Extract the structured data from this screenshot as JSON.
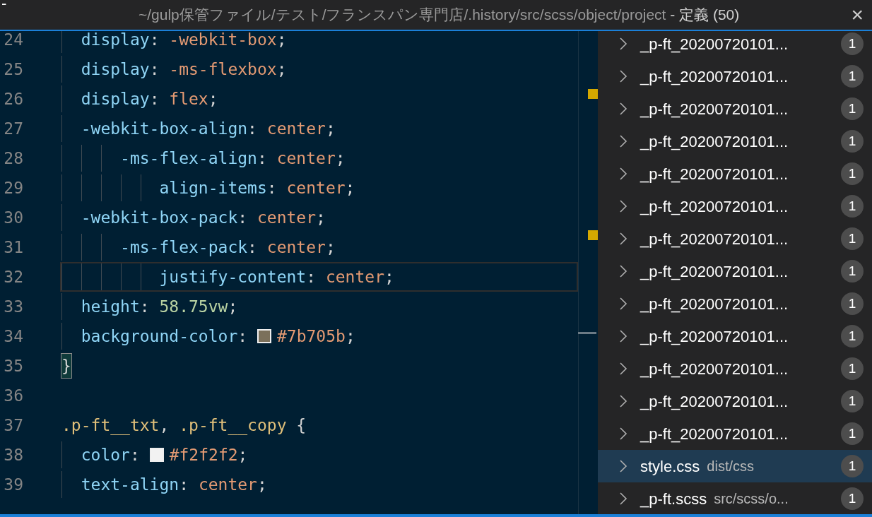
{
  "window": {
    "title_path": "~/gulp保管ファイル/テスト/フランスパン専門店/.history/src/scss/object/project",
    "title_suffix": " - 定義 (50)",
    "close": "×"
  },
  "tab_fragments": [
    "-"
  ],
  "editor": {
    "lines": [
      {
        "number": "24",
        "current": false,
        "tokens": [
          {
            "kind": "property",
            "text": "  display"
          },
          {
            "kind": "punct",
            "text": ": "
          },
          {
            "kind": "value",
            "text": "-webkit-box"
          },
          {
            "kind": "punct",
            "text": ";"
          }
        ]
      },
      {
        "number": "25",
        "current": false,
        "tokens": [
          {
            "kind": "property",
            "text": "  display"
          },
          {
            "kind": "punct",
            "text": ": "
          },
          {
            "kind": "value",
            "text": "-ms-flexbox"
          },
          {
            "kind": "punct",
            "text": ";"
          }
        ]
      },
      {
        "number": "26",
        "current": false,
        "tokens": [
          {
            "kind": "property",
            "text": "  display"
          },
          {
            "kind": "punct",
            "text": ": "
          },
          {
            "kind": "value",
            "text": "flex"
          },
          {
            "kind": "punct",
            "text": ";"
          }
        ]
      },
      {
        "number": "27",
        "current": false,
        "tokens": [
          {
            "kind": "property",
            "text": "  -webkit-box-align"
          },
          {
            "kind": "punct",
            "text": ": "
          },
          {
            "kind": "value",
            "text": "center"
          },
          {
            "kind": "punct",
            "text": ";"
          }
        ]
      },
      {
        "number": "28",
        "current": false,
        "tokens": [
          {
            "kind": "property",
            "text": "      -ms-flex-align"
          },
          {
            "kind": "punct",
            "text": ": "
          },
          {
            "kind": "value",
            "text": "center"
          },
          {
            "kind": "punct",
            "text": ";"
          }
        ]
      },
      {
        "number": "29",
        "current": false,
        "tokens": [
          {
            "kind": "property",
            "text": "          align-items"
          },
          {
            "kind": "punct",
            "text": ": "
          },
          {
            "kind": "value",
            "text": "center"
          },
          {
            "kind": "punct",
            "text": ";"
          }
        ]
      },
      {
        "number": "30",
        "current": false,
        "tokens": [
          {
            "kind": "property",
            "text": "  -webkit-box-pack"
          },
          {
            "kind": "punct",
            "text": ": "
          },
          {
            "kind": "value",
            "text": "center"
          },
          {
            "kind": "punct",
            "text": ";"
          }
        ]
      },
      {
        "number": "31",
        "current": false,
        "tokens": [
          {
            "kind": "property",
            "text": "      -ms-flex-pack"
          },
          {
            "kind": "punct",
            "text": ": "
          },
          {
            "kind": "value",
            "text": "center"
          },
          {
            "kind": "punct",
            "text": ";"
          }
        ]
      },
      {
        "number": "32",
        "current": true,
        "tokens": [
          {
            "kind": "property",
            "text": "          justify-content"
          },
          {
            "kind": "punct",
            "text": ": "
          },
          {
            "kind": "value",
            "text": "center"
          },
          {
            "kind": "punct",
            "text": ";"
          }
        ]
      },
      {
        "number": "33",
        "current": false,
        "tokens": [
          {
            "kind": "property",
            "text": "  height"
          },
          {
            "kind": "punct",
            "text": ": "
          },
          {
            "kind": "number",
            "text": "58.75vw"
          },
          {
            "kind": "punct",
            "text": ";"
          }
        ]
      },
      {
        "number": "34",
        "current": false,
        "tokens": [
          {
            "kind": "property",
            "text": "  background-color"
          },
          {
            "kind": "punct",
            "text": ": "
          },
          {
            "kind": "color",
            "text": "#7b705b",
            "color": "#7b705b"
          },
          {
            "kind": "punct",
            "text": ";"
          }
        ]
      },
      {
        "number": "35",
        "current": false,
        "tokens": [
          {
            "kind": "bracket",
            "text": "}"
          }
        ]
      },
      {
        "number": "36",
        "current": false
      },
      {
        "number": "37",
        "current": false,
        "tokens": [
          {
            "kind": "selector",
            "text": ".p-ft__txt"
          },
          {
            "kind": "punct",
            "text": ", "
          },
          {
            "kind": "selector",
            "text": ".p-ft__copy"
          },
          {
            "kind": "punct",
            "text": " {"
          }
        ]
      },
      {
        "number": "38",
        "current": false,
        "tokens": [
          {
            "kind": "property",
            "text": "  color"
          },
          {
            "kind": "punct",
            "text": ": "
          },
          {
            "kind": "color",
            "text": "#f2f2f2",
            "color": "#f2f2f2"
          },
          {
            "kind": "punct",
            "text": ";"
          }
        ]
      },
      {
        "number": "39",
        "current": false,
        "tokens": [
          {
            "kind": "property",
            "text": "  text-align"
          },
          {
            "kind": "punct",
            "text": ": "
          },
          {
            "kind": "value",
            "text": "center"
          },
          {
            "kind": "punct",
            "text": ";"
          }
        ]
      }
    ]
  },
  "references": [
    {
      "name": "_p-ft_20200720101...",
      "count": "1",
      "selected": false
    },
    {
      "name": "_p-ft_20200720101...",
      "count": "1",
      "selected": false
    },
    {
      "name": "_p-ft_20200720101...",
      "count": "1",
      "selected": false
    },
    {
      "name": "_p-ft_20200720101...",
      "count": "1",
      "selected": false
    },
    {
      "name": "_p-ft_20200720101...",
      "count": "1",
      "selected": false
    },
    {
      "name": "_p-ft_20200720101...",
      "count": "1",
      "selected": false
    },
    {
      "name": "_p-ft_20200720101...",
      "count": "1",
      "selected": false
    },
    {
      "name": "_p-ft_20200720101...",
      "count": "1",
      "selected": false
    },
    {
      "name": "_p-ft_20200720101...",
      "count": "1",
      "selected": false
    },
    {
      "name": "_p-ft_20200720101...",
      "count": "1",
      "selected": false
    },
    {
      "name": "_p-ft_20200720101...",
      "count": "1",
      "selected": false
    },
    {
      "name": "_p-ft_20200720101...",
      "count": "1",
      "selected": false
    },
    {
      "name": "_p-ft_20200720101...",
      "count": "1",
      "selected": false
    },
    {
      "name": "style.css",
      "path": "dist/css",
      "count": "1",
      "selected": true
    },
    {
      "name": "_p-ft.scss",
      "path": "src/scss/o...",
      "count": "1",
      "selected": false
    }
  ]
}
